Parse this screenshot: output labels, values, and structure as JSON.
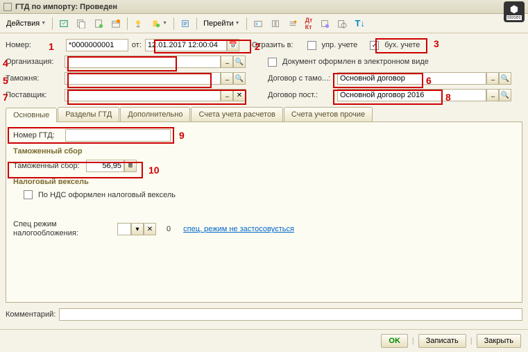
{
  "title": "ГТД по импорту: Проведен",
  "toolbar": {
    "actions": "Действия",
    "goto": "Перейти"
  },
  "fields": {
    "number_label": "Номер:",
    "number_value": "*0000000001",
    "from_label": "от:",
    "date_value": "12.01.2017 12:00:04",
    "reflect_label": "Отразить в:",
    "upr_label": "упр. учете",
    "buh_label": "бух. учете",
    "org_label": "Организация:",
    "org_value": "",
    "customs_label": "Таможня:",
    "customs_value": "",
    "supplier_label": "Поставщик:",
    "supplier_value": "",
    "doc_electronic": "Документ оформлен в электронном виде",
    "contract_customs_label": "Договор с тамо...:",
    "contract_customs_value": "Основной договор",
    "contract_supplier_label": "Договор пост.:",
    "contract_supplier_value": "Основной договор 2016"
  },
  "tabs": {
    "t1": "Основные",
    "t2": "Разделы ГТД",
    "t3": "Дополнительно",
    "t4": "Счета учета расчетов",
    "t5": "Счета учетов прочие"
  },
  "tab_content": {
    "gtd_number_label": "Номер ГТД:",
    "gtd_number_value": "",
    "customs_fee_section": "Таможенный сбор",
    "customs_fee_label": "Таможенный сбор:",
    "customs_fee_value": "56,95",
    "tax_bill_section": "Налоговый вексель",
    "vat_bill_label": "По НДС оформлен налоговый вексель",
    "spec_mode_label1": "Спец режим",
    "spec_mode_label2": "налогообложения:",
    "spec_mode_value": "0",
    "spec_mode_link": "спец. режим не застосовується"
  },
  "comment_label": "Комментарий:",
  "comment_value": "",
  "buttons": {
    "ok": "OK",
    "save": "Записать",
    "close": "Закрыть"
  },
  "badges": {
    "b1": "1",
    "b2": "2",
    "b3": "3",
    "b4": "4",
    "b5": "5",
    "b6": "6",
    "b7": "7",
    "b8": "8",
    "b9": "9",
    "b10": "10"
  },
  "logo_text": "stosec"
}
